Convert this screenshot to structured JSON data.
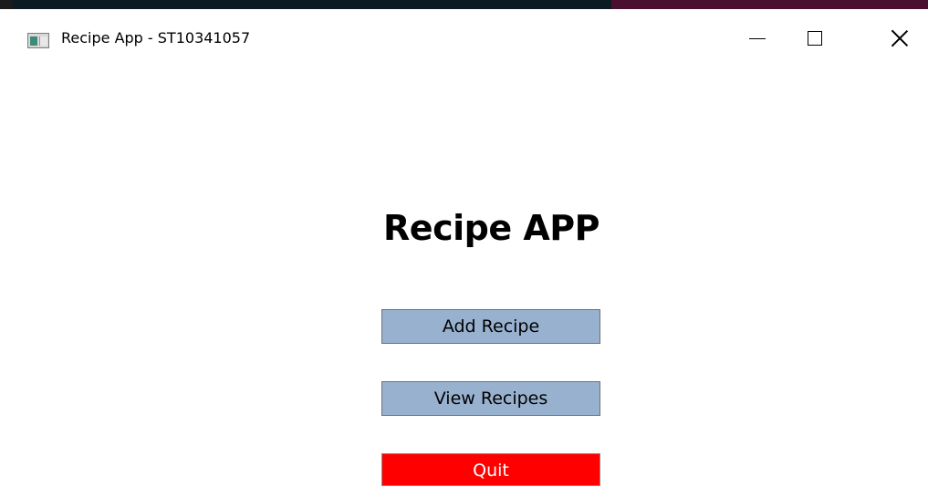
{
  "window": {
    "title": "Recipe App - ST10341057"
  },
  "icons": {
    "app": "app-window-icon",
    "minimize": "minimize-icon",
    "maximize": "maximize-icon",
    "close": "close-icon"
  },
  "main": {
    "heading": "Recipe APP",
    "buttons": {
      "add": "Add Recipe",
      "view": "View Recipes",
      "quit": "Quit"
    }
  },
  "colors": {
    "primary_button": "#98b1cf",
    "quit_button": "#ff0000",
    "quit_text": "#ffffff"
  }
}
